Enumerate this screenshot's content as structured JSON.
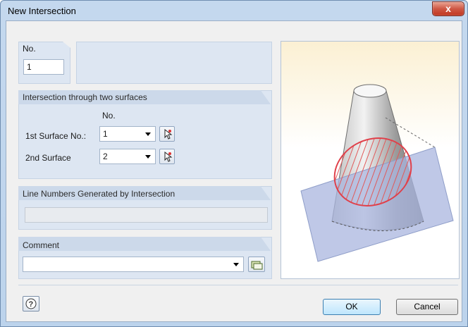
{
  "window": {
    "title": "New Intersection",
    "close_label": "x"
  },
  "no_section": {
    "label": "No.",
    "value": "1"
  },
  "intersection_section": {
    "title": "Intersection through two surfaces",
    "column_header": "No.",
    "first_surface": {
      "label": "1st Surface No.:",
      "value": "1"
    },
    "second_surface": {
      "label": "2nd Surface",
      "value": "2"
    }
  },
  "lines_section": {
    "title": "Line Numbers Generated by Intersection",
    "value": ""
  },
  "comment_section": {
    "title": "Comment",
    "value": ""
  },
  "buttons": {
    "ok": "OK",
    "cancel": "Cancel"
  },
  "colors": {
    "accent": "#3c7fb1",
    "panel": "#dde6f2",
    "intersection_line": "#e0404a"
  }
}
